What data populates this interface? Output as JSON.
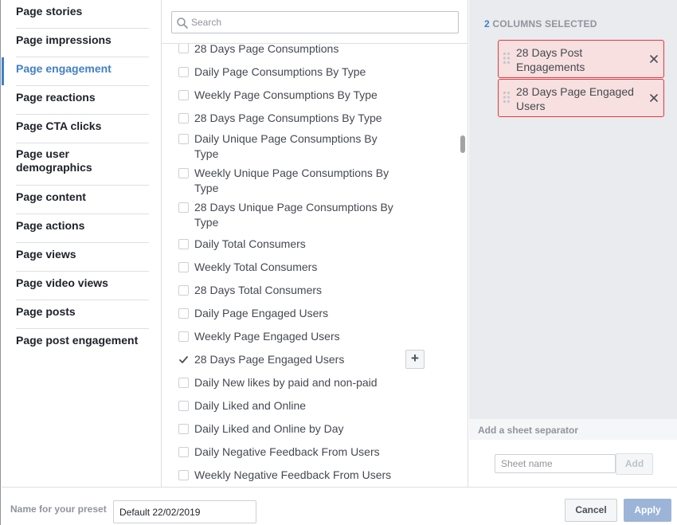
{
  "sidebar": {
    "items": [
      {
        "label": "Page stories"
      },
      {
        "label": "Page impressions"
      },
      {
        "label": "Page engagement"
      },
      {
        "label": "Page reactions"
      },
      {
        "label": "Page CTA clicks"
      },
      {
        "label": "Page user demographics"
      },
      {
        "label": "Page content"
      },
      {
        "label": "Page actions"
      },
      {
        "label": "Page views"
      },
      {
        "label": "Page video views"
      },
      {
        "label": "Page posts"
      },
      {
        "label": "Page post engagement"
      }
    ],
    "active_item": "Page engagement"
  },
  "search": {
    "placeholder": "Search",
    "value": ""
  },
  "metrics_list": {
    "items": [
      {
        "label": "28 Days Page Consumptions",
        "checked": false
      },
      {
        "label": "Daily Page Consumptions By Type",
        "checked": false
      },
      {
        "label": "Weekly Page Consumptions By Type",
        "checked": false
      },
      {
        "label": "28 Days Page Consumptions By Type",
        "checked": false
      },
      {
        "label": "Daily Unique Page Consumptions By Type",
        "checked": false
      },
      {
        "label": "Weekly Unique Page Consumptions By Type",
        "checked": false
      },
      {
        "label": "28 Days Unique Page Consumptions By Type",
        "checked": false
      },
      {
        "label": "Daily Total Consumers",
        "checked": false
      },
      {
        "label": "Weekly Total Consumers",
        "checked": false
      },
      {
        "label": "28 Days Total Consumers",
        "checked": false
      },
      {
        "label": "Daily Page Engaged Users",
        "checked": false
      },
      {
        "label": "Weekly Page Engaged Users",
        "checked": false
      },
      {
        "label": "28 Days Page Engaged Users",
        "checked": true
      },
      {
        "label": "Daily New likes by paid and non-paid",
        "checked": false
      },
      {
        "label": "Daily Liked and Online",
        "checked": false
      },
      {
        "label": "Daily Liked and Online by Day",
        "checked": false
      },
      {
        "label": "Daily Negative Feedback From Users",
        "checked": false
      },
      {
        "label": "Weekly Negative Feedback From Users",
        "checked": false
      }
    ],
    "add_label": "+"
  },
  "selected": {
    "count": "2",
    "header_suffix": "COLUMNS SELECTED",
    "columns": [
      {
        "label": "28 Days Post Engagements"
      },
      {
        "label": "28 Days Page Engaged Users"
      }
    ]
  },
  "separator": {
    "title": "Add a sheet separator",
    "sheet_placeholder": "Sheet name",
    "add_label": "Add"
  },
  "footer": {
    "preset_label": "Name for your preset",
    "preset_value": "Default 22/02/2019",
    "cancel_label": "Cancel",
    "apply_label": "Apply"
  },
  "colors": {
    "accent": "#4080c8",
    "chip_border": "#e4373f",
    "chip_bg": "#f8e0e0",
    "apply_disabled": "#9cb4d8"
  },
  "icons": [
    "search-icon",
    "checkmark-icon",
    "plus-icon",
    "drag-handle-icon",
    "close-icon"
  ]
}
